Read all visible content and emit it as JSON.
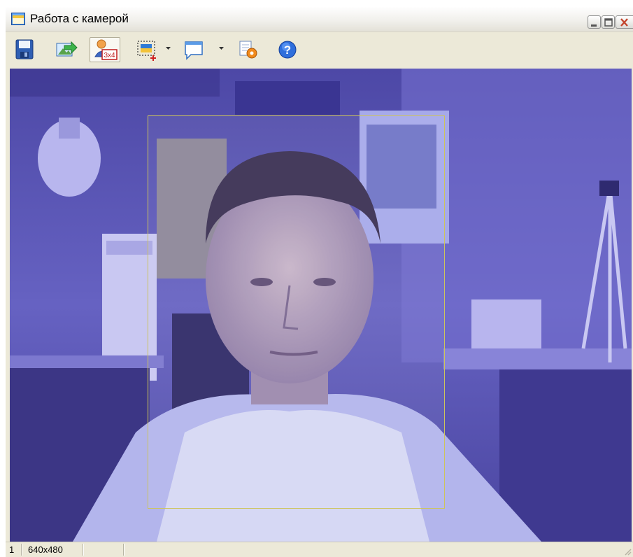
{
  "window": {
    "title": "Работа с камерой",
    "icon": "window-app-icon",
    "controls": [
      "minimize-icon",
      "maximize-icon",
      "close-icon"
    ]
  },
  "toolbar": {
    "buttons": [
      {
        "name": "save",
        "icon": "floppy-disk-icon"
      },
      {
        "name": "export",
        "icon": "image-arrow-icon"
      },
      {
        "name": "photo-3x4",
        "icon": "portrait-3x4-icon",
        "label": "3x4",
        "active": true
      },
      {
        "name": "select-area",
        "icon": "select-region-icon",
        "dropdown": true
      },
      {
        "name": "frame",
        "icon": "window-frame-icon",
        "dropdown": true
      },
      {
        "name": "settings",
        "icon": "gear-settings-icon"
      },
      {
        "name": "help",
        "icon": "help-icon",
        "label": "?"
      }
    ]
  },
  "statusbar": {
    "camera_number": "1",
    "resolution": "640x480"
  },
  "colors": {
    "accent_yellow_frame": "#cdc45d",
    "video_tint": "#5d58b7"
  }
}
